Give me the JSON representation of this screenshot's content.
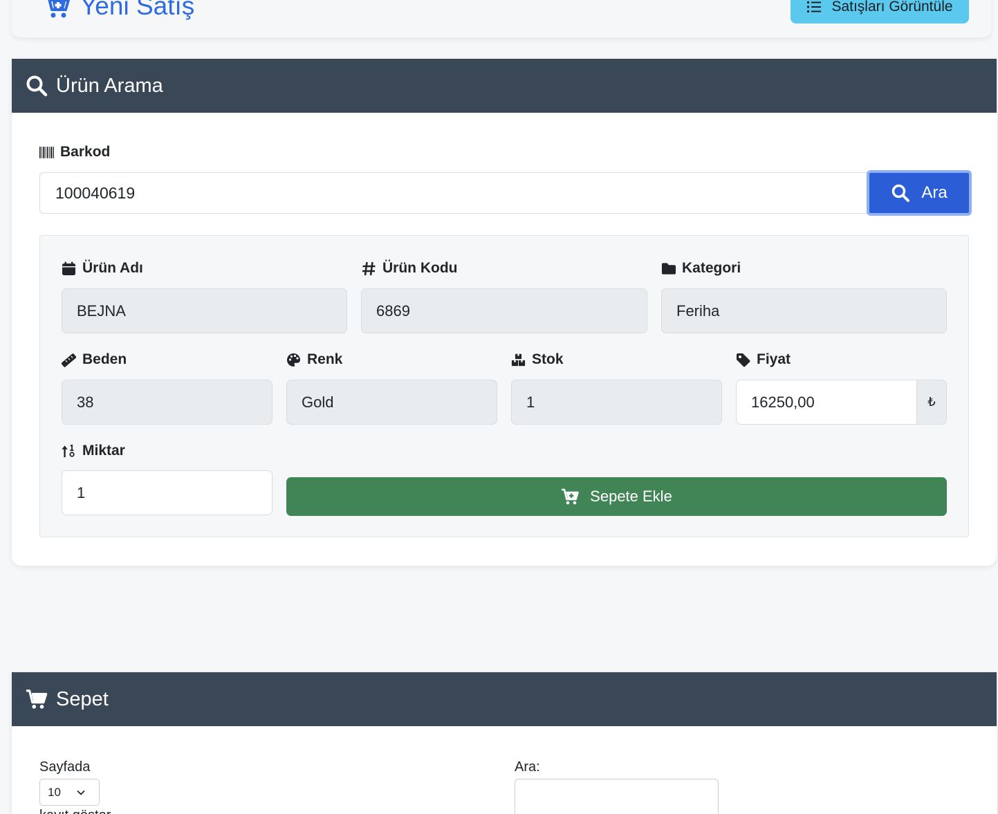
{
  "header": {
    "title": "Yeni Satış",
    "view_sales_label": "Satışları Görüntüle"
  },
  "search_card": {
    "title": "Ürün Arama",
    "barcode_label": "Barkod",
    "barcode_value": "100040619",
    "search_button_label": "Ara",
    "fields": {
      "product_name_label": "Ürün Adı",
      "product_name_value": "BEJNA",
      "product_code_label": "Ürün Kodu",
      "product_code_value": "6869",
      "category_label": "Kategori",
      "category_value": "Feriha",
      "size_label": "Beden",
      "size_value": "38",
      "color_label": "Renk",
      "color_value": "Gold",
      "stock_label": "Stok",
      "stock_value": "1",
      "price_label": "Fiyat",
      "price_value": "16250,00",
      "currency_symbol": "₺",
      "quantity_label": "Miktar",
      "quantity_value": "1"
    },
    "add_to_cart_label": "Sepete Ekle"
  },
  "cart_card": {
    "title": "Sepet",
    "page_size_label": "Sayfada",
    "page_size_value": "10",
    "search_label": "Ara:",
    "cutoff_text": "kayıt göster"
  },
  "colors": {
    "accent": "#2f6be0",
    "card_header": "#394757",
    "info_button": "#5bc8ee",
    "primary_button": "#2b5dd6",
    "success_button": "#418556"
  }
}
